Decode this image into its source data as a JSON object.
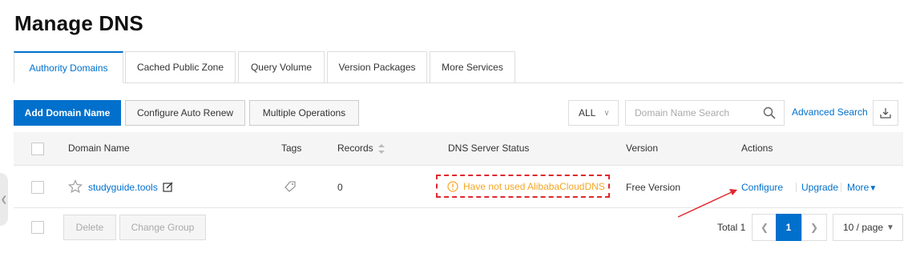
{
  "page": {
    "title": "Manage DNS"
  },
  "tabs": [
    {
      "label": "Authority Domains",
      "active": true
    },
    {
      "label": "Cached Public Zone",
      "active": false
    },
    {
      "label": "Query Volume",
      "active": false
    },
    {
      "label": "Version Packages",
      "active": false
    },
    {
      "label": "More Services",
      "active": false
    }
  ],
  "toolbar": {
    "add_domain": "Add Domain Name",
    "auto_renew": "Configure Auto Renew",
    "multiple_ops": "Multiple Operations",
    "filter_value": "ALL",
    "search_placeholder": "Domain Name Search",
    "advanced_search": "Advanced Search"
  },
  "table": {
    "headers": {
      "domain": "Domain Name",
      "tags": "Tags",
      "records": "Records",
      "status": "DNS Server Status",
      "version": "Version",
      "actions": "Actions"
    },
    "rows": [
      {
        "domain": "studyguide.tools",
        "records": "0",
        "status": "Have not used AlibabaCloudDNS",
        "version": "Free Version",
        "actions": {
          "configure": "Configure",
          "upgrade": "Upgrade",
          "more": "More"
        }
      }
    ]
  },
  "footer": {
    "delete": "Delete",
    "change_group": "Change Group",
    "total_label": "Total 1",
    "current_page": "1",
    "page_size": "10 / page"
  },
  "colors": {
    "accent": "#0070cc",
    "warning_text": "#f5a623",
    "annotation_red": "#e0282e"
  },
  "icons": [
    "star-icon",
    "edit-icon",
    "tag-icon",
    "sort-icon",
    "warning-icon",
    "search-icon",
    "download-icon",
    "chevron-down-icon",
    "chevron-left-icon",
    "chevron-right-icon"
  ]
}
